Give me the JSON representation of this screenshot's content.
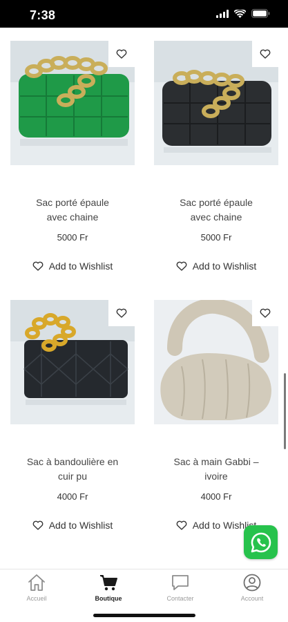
{
  "status_bar": {
    "time": "7:38",
    "icons": [
      "signal-icon",
      "wifi-icon",
      "battery-icon"
    ]
  },
  "products": [
    {
      "title_line1": "Sac porté épaule",
      "title_line2": "avec chaine",
      "price": "5000 Fr",
      "wishlist_label": "Add to Wishlist",
      "bag_color": "#1f9a48",
      "bg_color": "#e8edf1"
    },
    {
      "title_line1": "Sac porté épaule",
      "title_line2": "avec chaine",
      "price": "5000 Fr",
      "wishlist_label": "Add to Wishlist",
      "bag_color": "#2b2e31",
      "bg_color": "#e8edf1"
    },
    {
      "title_line1": "Sac à bandoulière en",
      "title_line2": "cuir pu",
      "price": "4000 Fr",
      "wishlist_label": "Add to Wishlist",
      "bag_color": "#25292e",
      "bg_color": "#e8edf1"
    },
    {
      "title_line1": "Sac à main Gabbi –",
      "title_line2": "ivoire",
      "price": "4000 Fr",
      "wishlist_label": "Add to Wishlist",
      "bag_color": "#d2cbbb",
      "bg_color": "#eceff2"
    }
  ],
  "tabs": [
    {
      "label": "Accueil",
      "icon": "home-icon",
      "active": false
    },
    {
      "label": "Boutique",
      "icon": "cart-icon",
      "active": true
    },
    {
      "label": "Contacter",
      "icon": "chat-icon",
      "active": false
    },
    {
      "label": "Account",
      "icon": "account-icon",
      "active": false
    }
  ],
  "colors": {
    "status_bar": "#000000",
    "whatsapp": "#27c24c",
    "text": "#444444",
    "tab_inactive": "#9a9a9a",
    "tab_active": "#222222"
  }
}
